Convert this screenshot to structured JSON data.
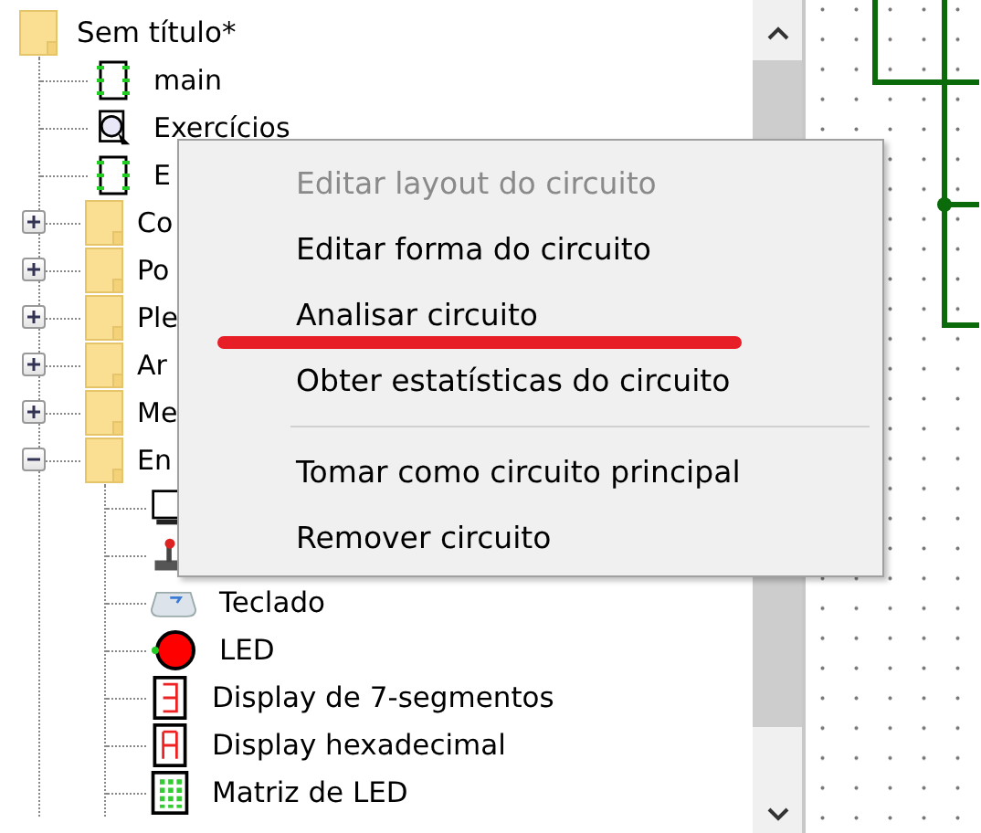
{
  "tree": {
    "label": "Sem título*",
    "kind": "folder",
    "children": [
      {
        "label": "main",
        "kind": "circuit"
      },
      {
        "label": "Exercícios",
        "kind": "probe-circuit"
      },
      {
        "label": "E",
        "kind": "circuit"
      },
      {
        "label": "Co",
        "kind": "folder",
        "expanded": false
      },
      {
        "label": "Po",
        "kind": "folder",
        "expanded": false
      },
      {
        "label": "Ple",
        "kind": "folder",
        "expanded": false
      },
      {
        "label": "Ar",
        "kind": "folder",
        "expanded": false
      },
      {
        "label": "Me",
        "kind": "folder",
        "expanded": false
      },
      {
        "label": "En",
        "kind": "folder",
        "expanded": true,
        "children": [
          {
            "kind": "monitor"
          },
          {
            "kind": "joystick"
          },
          {
            "label": "Teclado",
            "kind": "keyboard"
          },
          {
            "label": "LED",
            "kind": "led"
          },
          {
            "label": "Display de 7-segmentos",
            "kind": "seven-segment"
          },
          {
            "label": "Display hexadecimal",
            "kind": "hex-display"
          },
          {
            "label": "Matriz de LED",
            "kind": "led-matrix"
          }
        ]
      }
    ]
  },
  "context_menu": {
    "items": [
      {
        "kind": "item",
        "label": "Editar layout do circuito",
        "disabled": true,
        "marked": false
      },
      {
        "kind": "item",
        "label": "Editar forma do circuito",
        "disabled": false,
        "marked": false
      },
      {
        "kind": "item",
        "label": "Analisar circuito",
        "disabled": false,
        "marked": true
      },
      {
        "kind": "item",
        "label": "Obter estatísticas do circuito",
        "disabled": false,
        "marked": false
      },
      {
        "kind": "separator"
      },
      {
        "kind": "item",
        "label": "Tomar como circuito principal",
        "disabled": false,
        "marked": false
      },
      {
        "kind": "item",
        "label": "Remover circuito",
        "disabled": false,
        "marked": false
      }
    ]
  }
}
